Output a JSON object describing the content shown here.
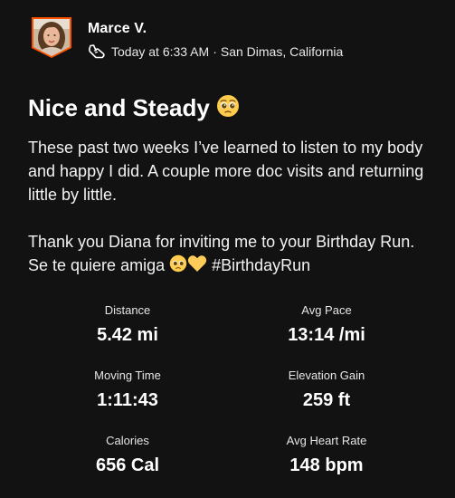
{
  "athlete": {
    "name": "Marce V.",
    "timestamp": "Today at 6:33 AM",
    "separator": "·",
    "location": "San Dimas, California",
    "activity_icon": "running-shoe-icon"
  },
  "activity": {
    "title": "Nice and Steady",
    "title_emoji": "pleading-face",
    "description_paragraph_1": "These past two weeks I’ve learned to listen to my body and happy I did. A couple more doc visits and returning little by little.",
    "description_paragraph_2_text": "Thank you Diana for inviting me to your Birthday Run. Se te quiere amiga",
    "description_paragraph_2_emojis": [
      "pleading-face",
      "yellow-heart"
    ],
    "hashtag": "#BirthdayRun"
  },
  "stats": [
    {
      "label": "Distance",
      "value": "5.42 mi"
    },
    {
      "label": "Avg Pace",
      "value": "13:14 /mi"
    },
    {
      "label": "Moving Time",
      "value": "1:11:43"
    },
    {
      "label": "Elevation Gain",
      "value": "259 ft"
    },
    {
      "label": "Calories",
      "value": "656 Cal"
    },
    {
      "label": "Avg Heart Rate",
      "value": "148 bpm"
    }
  ],
  "colors": {
    "background": "#121212",
    "avatar_border": "#fc5200",
    "text": "#ffffff"
  }
}
